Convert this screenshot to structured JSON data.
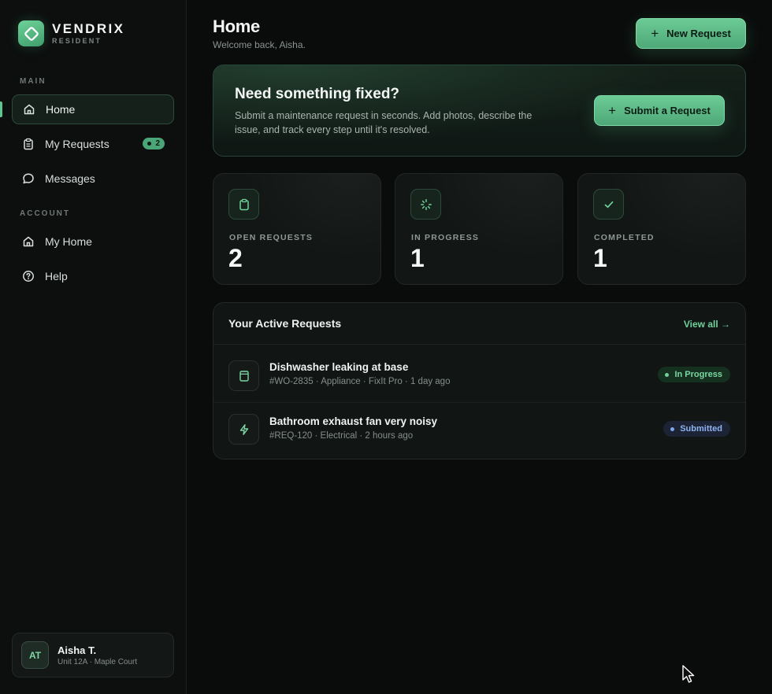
{
  "brand": {
    "name": "VENDRIX",
    "subtitle": "RESIDENT"
  },
  "sidebar": {
    "sections": [
      {
        "label": "MAIN"
      },
      {
        "label": "ACCOUNT"
      }
    ],
    "items": [
      {
        "label": "Home",
        "icon": "home-icon",
        "active": true
      },
      {
        "label": "My Requests",
        "icon": "clipboard-icon",
        "badge": "2"
      },
      {
        "label": "Messages",
        "icon": "chat-bubble-icon"
      },
      {
        "label": "My Home",
        "icon": "house-icon"
      },
      {
        "label": "Help",
        "icon": "help-circle-icon"
      }
    ]
  },
  "user": {
    "initials": "AT",
    "name": "Aisha T.",
    "unit": "Unit 12A · Maple Court"
  },
  "header": {
    "title": "Home",
    "subtitle": "Welcome back, Aisha.",
    "new_request_label": "New Request"
  },
  "hero": {
    "title": "Need something fixed?",
    "description": "Submit a maintenance request in seconds. Add photos, describe the issue, and track every step until it's resolved.",
    "button_label": "Submit a Request"
  },
  "stats": [
    {
      "label": "OPEN REQUESTS",
      "value": "2",
      "icon": "clipboard-icon"
    },
    {
      "label": "IN PROGRESS",
      "value": "1",
      "icon": "loader-icon"
    },
    {
      "label": "COMPLETED",
      "value": "1",
      "icon": "check-icon"
    }
  ],
  "active_requests": {
    "title": "Your Active Requests",
    "view_all_label": "View all →",
    "rows": [
      {
        "title": "Dishwasher leaking at base",
        "meta": "#WO-2835 · Appliance · FixIt Pro · 1 day ago",
        "status": "In Progress",
        "icon": "appliance-icon"
      },
      {
        "title": "Bathroom exhaust fan very noisy",
        "meta": "#REQ-120 · Electrical · 2 hours ago",
        "status": "Submitted",
        "icon": "lightning-icon"
      }
    ]
  },
  "colors": {
    "accent": "#5fc58d",
    "background": "#0a0c0b",
    "status_in_progress": "#79d7a2",
    "status_submitted": "#8fb2f0"
  }
}
